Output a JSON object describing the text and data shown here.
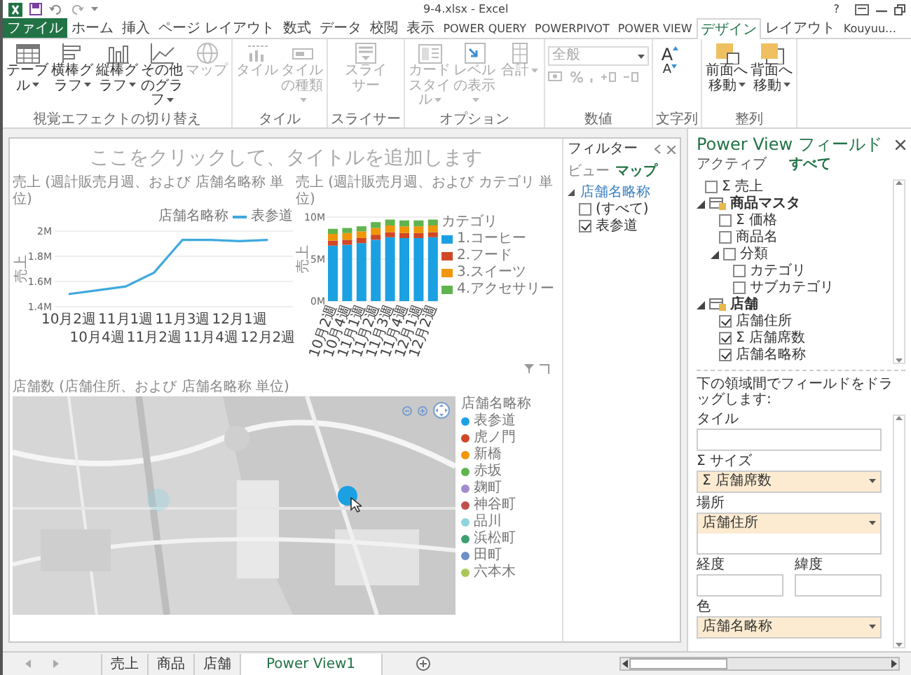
{
  "window": {
    "title": "9-4.xlsx - Excel",
    "help": "?"
  },
  "ribbon_tabs": [
    {
      "label": "ファイル",
      "kind": "file",
      "selected": false
    },
    {
      "label": "ホーム",
      "kind": "tab",
      "selected": false
    },
    {
      "label": "挿入",
      "kind": "tab",
      "selected": false
    },
    {
      "label": "ページ レイアウト",
      "kind": "tab",
      "selected": false
    },
    {
      "label": "数式",
      "kind": "tab",
      "selected": false
    },
    {
      "label": "データ",
      "kind": "tab",
      "selected": false
    },
    {
      "label": "校閲",
      "kind": "tab",
      "selected": false
    },
    {
      "label": "表示",
      "kind": "tab",
      "selected": false
    },
    {
      "label": "POWER QUERY",
      "kind": "tab",
      "selected": false
    },
    {
      "label": "POWERPIVOT",
      "kind": "tab",
      "selected": false
    },
    {
      "label": "POWER VIEW",
      "kind": "tab",
      "selected": false
    },
    {
      "label": "デザイン",
      "kind": "tab",
      "selected": true
    },
    {
      "label": "レイアウト",
      "kind": "tab",
      "selected": false
    },
    {
      "label": "Kouyuu…",
      "kind": "user",
      "selected": false
    }
  ],
  "ribbon_groups": [
    {
      "label": "視覚エフェクトの切り替え",
      "items": [
        {
          "kind": "table",
          "label": "テーブル",
          "dropdown": true,
          "disabled": false
        },
        {
          "kind": "bar",
          "label": "横棒グラフ",
          "dropdown": true,
          "disabled": false
        },
        {
          "kind": "column",
          "label": "縦棒グラフ",
          "dropdown": true,
          "disabled": false
        },
        {
          "kind": "line",
          "label": "その他のグラフ",
          "dropdown": true,
          "disabled": false
        },
        {
          "kind": "map",
          "label": "マップ",
          "dropdown": false,
          "disabled": true
        }
      ]
    },
    {
      "label": "タイル",
      "items": [
        {
          "kind": "tile",
          "label": "タイル",
          "dropdown": false,
          "disabled": true
        },
        {
          "kind": "tiletype",
          "label": "タイルの種類",
          "dropdown": true,
          "disabled": true
        }
      ]
    },
    {
      "label": "スライサー",
      "items": [
        {
          "kind": "slicer",
          "label": "スライサー",
          "dropdown": false,
          "disabled": true
        }
      ]
    },
    {
      "label": "オプション",
      "items": [
        {
          "kind": "card",
          "label": "カードスタイル",
          "dropdown": true,
          "disabled": true
        },
        {
          "kind": "level",
          "label": "レベルの表示",
          "dropdown": true,
          "disabled": true
        },
        {
          "kind": "total",
          "label": "合計",
          "dropdown": true,
          "disabled": true
        }
      ]
    },
    {
      "label": "数値",
      "items": [
        {
          "kind": "format",
          "label": "全般",
          "dropdown": true,
          "disabled": true
        }
      ]
    },
    {
      "label": "文字列",
      "items": [
        {
          "kind": "grow",
          "label": "A",
          "disabled": false
        },
        {
          "kind": "shrink",
          "label": "A",
          "disabled": false
        }
      ]
    },
    {
      "label": "整列",
      "items": [
        {
          "kind": "front",
          "label": "前面へ移動",
          "dropdown": true,
          "disabled": false
        },
        {
          "kind": "back",
          "label": "背面へ移動",
          "dropdown": true,
          "disabled": false
        }
      ]
    }
  ],
  "canvas": {
    "title": "ここをクリックして、タイトルを追加します",
    "line_chart": {
      "legend_title": "店舗名略称",
      "chart_data": {
        "type": "line",
        "legend": "top",
        "title": "売上 (週計販売月週、および 店舗名略称 単位)",
        "ylabel": "売上",
        "categories": [
          "10月2週",
          "10月4週",
          "11月1週",
          "11月2週",
          "11月3週",
          "11月4週",
          "12月1週",
          "12月2週"
        ],
        "series": [
          {
            "name": "表参道",
            "color": "#3fa9dd",
            "values": [
              1.5,
              1.53,
              1.56,
              1.67,
              1.93,
              1.93,
              1.92,
              1.93
            ]
          }
        ],
        "ylim": [
          1.4,
          2.0
        ],
        "yticks": [
          {
            "value": 1.4,
            "label": "1.4M"
          },
          {
            "value": 1.6,
            "label": "1.6M"
          },
          {
            "value": 1.8,
            "label": "1.8M"
          },
          {
            "value": 2.0,
            "label": "2M"
          }
        ]
      }
    },
    "bar_chart": {
      "legend_title": "カテゴリ",
      "chart_data": {
        "type": "bar",
        "legend": "right",
        "title": "売上 (週計販売月週、および カテゴリ 単位)",
        "ylabel": "売上",
        "stacked": true,
        "categories": [
          "10月2週",
          "10月4週",
          "11月1週",
          "11月2週",
          "11月3週",
          "11月4週",
          "12月1週",
          "12月2週"
        ],
        "series": [
          {
            "name": "1.コーヒー",
            "color": "#1ba1e2",
            "values": [
              6.6,
              6.7,
              6.9,
              7.3,
              7.6,
              7.5,
              7.5,
              7.6
            ]
          },
          {
            "name": "2.フード",
            "color": "#d24726",
            "values": [
              0.6,
              0.6,
              0.6,
              0.6,
              0.6,
              0.6,
              0.6,
              0.6
            ]
          },
          {
            "name": "3.スイーツ",
            "color": "#f09609",
            "values": [
              0.8,
              0.8,
              0.8,
              0.8,
              0.8,
              0.8,
              0.8,
              0.8
            ]
          },
          {
            "name": "4.アクセサリー",
            "color": "#60b44d",
            "values": [
              0.6,
              0.6,
              0.6,
              0.7,
              0.7,
              0.7,
              0.7,
              0.7
            ]
          }
        ],
        "ylim": [
          0,
          10
        ],
        "yticks": [
          {
            "value": 0,
            "label": "0M"
          },
          {
            "value": 5,
            "label": "5M"
          },
          {
            "value": 10,
            "label": "10M"
          }
        ]
      }
    },
    "map": {
      "title": "店舗数 (店舗住所、および 店舗名略称 単位)",
      "legend_title": "店舗名略称",
      "legend": [
        {
          "label": "表参道",
          "color": "#1ba1e2"
        },
        {
          "label": "虎ノ門",
          "color": "#d24726"
        },
        {
          "label": "新橋",
          "color": "#f09609"
        },
        {
          "label": "赤坂",
          "color": "#60b44d"
        },
        {
          "label": "麹町",
          "color": "#a48ad0"
        },
        {
          "label": "神谷町",
          "color": "#c0504d"
        },
        {
          "label": "品川",
          "color": "#8fd3dc"
        },
        {
          "label": "浜松町",
          "color": "#3f9f6f"
        },
        {
          "label": "田町",
          "color": "#6f8fc8"
        },
        {
          "label": "六本木",
          "color": "#a8c85a"
        }
      ]
    }
  },
  "filter_pane": {
    "title": "フィルター",
    "tabs": [
      {
        "label": "ビュー",
        "selected": false
      },
      {
        "label": "マップ",
        "selected": true
      }
    ],
    "field": "店舗名略称",
    "values": [
      {
        "label": "(すべて)",
        "checked": false
      },
      {
        "label": "表参道",
        "checked": true
      }
    ]
  },
  "field_pane": {
    "title": "Power View フィールド",
    "tabs": [
      {
        "label": "アクティブ",
        "selected": false
      },
      {
        "label": "すべて",
        "selected": true
      }
    ],
    "fields": [
      {
        "kind": "field",
        "label": "Σ 売上",
        "checked": false
      },
      {
        "kind": "table",
        "label": "商品マスタ",
        "expanded": true,
        "children": [
          {
            "kind": "field",
            "label": "Σ 価格",
            "checked": false
          },
          {
            "kind": "field",
            "label": "商品名",
            "checked": false
          },
          {
            "kind": "field",
            "label": "分類",
            "checked": false,
            "expanded": true,
            "children": [
              {
                "kind": "field",
                "label": "カテゴリ",
                "checked": false
              },
              {
                "kind": "field",
                "label": "サブカテゴリ",
                "checked": false
              }
            ]
          }
        ]
      },
      {
        "kind": "table",
        "label": "店舗",
        "expanded": true,
        "children": [
          {
            "kind": "field",
            "label": "店舗住所",
            "checked": true
          },
          {
            "kind": "field",
            "label": "Σ 店舗席数",
            "checked": true
          },
          {
            "kind": "field",
            "label": "店舗名略称",
            "checked": true
          }
        ]
      }
    ],
    "hint": "下の領域間でフィールドをドラッグします:",
    "areas": [
      {
        "kind": "single",
        "label": "タイル"
      },
      {
        "kind": "single",
        "label": "Σ サイズ",
        "fields": [
          "Σ 店舗席数"
        ]
      },
      {
        "kind": "tall",
        "label": "場所",
        "fields": [
          "店舗住所"
        ]
      },
      {
        "kind": "pair",
        "items": [
          {
            "label": "経度"
          },
          {
            "label": "緯度"
          }
        ]
      },
      {
        "kind": "single",
        "label": "色",
        "fields": [
          "店舗名略称"
        ]
      }
    ]
  },
  "sheet_tabs": [
    {
      "label": "売上",
      "selected": false
    },
    {
      "label": "商品",
      "selected": false
    },
    {
      "label": "店舗",
      "selected": false
    },
    {
      "label": "Power View1",
      "selected": true
    }
  ]
}
